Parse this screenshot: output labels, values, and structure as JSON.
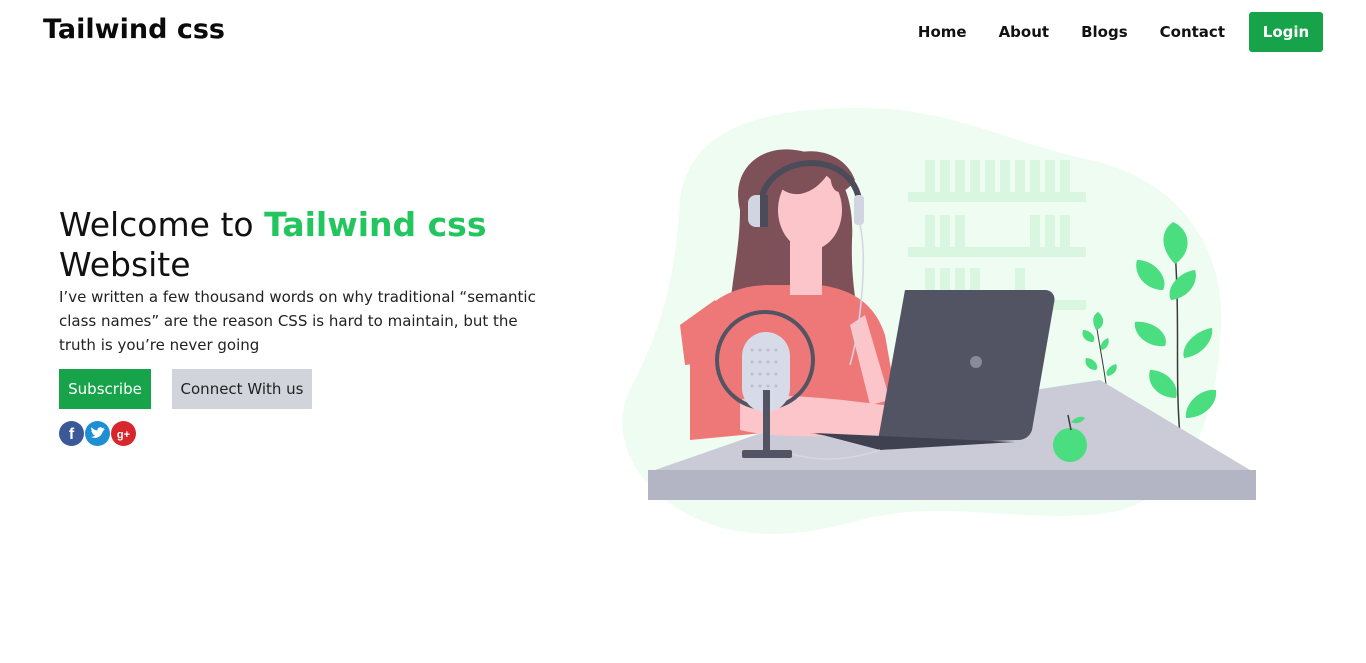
{
  "header": {
    "brand": "Tailwind css",
    "nav": [
      {
        "label": "Home"
      },
      {
        "label": "About"
      },
      {
        "label": "Blogs"
      },
      {
        "label": "Contact"
      }
    ],
    "login_label": "Login"
  },
  "hero": {
    "title_prefix": "Welcome to ",
    "title_accent": "Tailwind css",
    "title_suffix": "Website",
    "description": "I’ve written a few thousand words on why traditional “semantic class names” are the reason CSS is hard to maintain, but the truth is you’re never going",
    "subscribe_label": "Subscribe",
    "connect_label": "Connect With us",
    "socials": [
      {
        "icon": "facebook-icon",
        "glyph": "f",
        "color": "#3b5998"
      },
      {
        "icon": "twitter-icon",
        "glyph": "t",
        "color": "#1d8fd2"
      },
      {
        "icon": "google-plus-icon",
        "glyph": "g+",
        "color": "#d7272c"
      }
    ]
  },
  "colors": {
    "accent": "#22c55e",
    "button_green": "#16a34a",
    "button_gray": "#d1d5db"
  }
}
